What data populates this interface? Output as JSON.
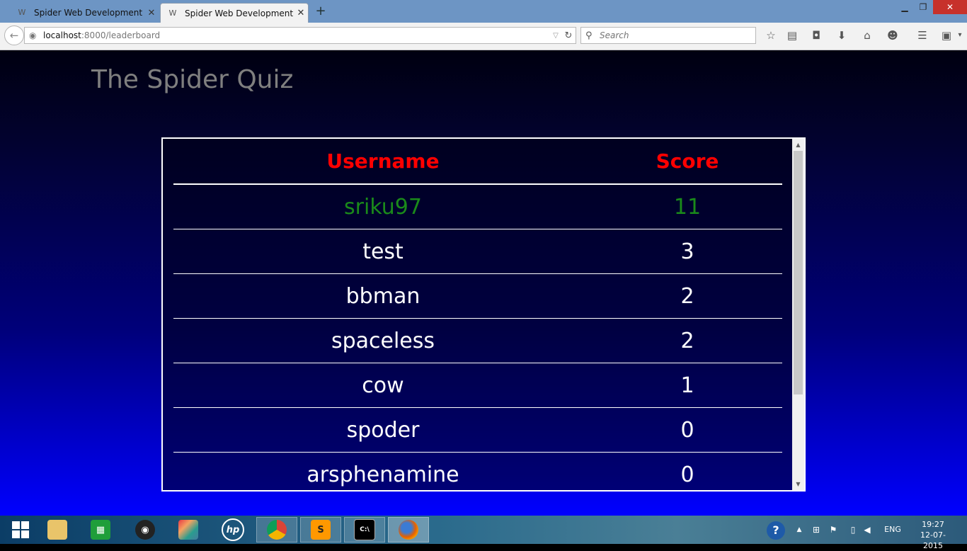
{
  "browser": {
    "tabs": [
      {
        "title": "Spider Web Development t...",
        "active": false
      },
      {
        "title": "Spider Web Development t...",
        "active": true
      }
    ],
    "new_tab": "+",
    "window": {
      "minimize": "▁",
      "maximize": "❐",
      "close": "✕"
    },
    "url": {
      "host": "localhost",
      "path": ":8000/leaderboard"
    },
    "search_placeholder": "Search"
  },
  "page": {
    "title": "The Spider Quiz",
    "leaderboard": {
      "headers": {
        "username": "Username",
        "score": "Score"
      },
      "rows": [
        {
          "username": "sriku97",
          "score": "11"
        },
        {
          "username": "test",
          "score": "3"
        },
        {
          "username": "bbman",
          "score": "2"
        },
        {
          "username": "spaceless",
          "score": "2"
        },
        {
          "username": "cow",
          "score": "1"
        },
        {
          "username": "spoder",
          "score": "0"
        },
        {
          "username": "arsphenamine",
          "score": "0"
        }
      ]
    },
    "colors": {
      "header": "#ff0000",
      "top_row": "#1a8a1a",
      "title": "#7f7f7f"
    }
  },
  "taskbar": {
    "tray": {
      "language": "ENG",
      "time": "19:27",
      "date": "12-07-2015"
    }
  }
}
